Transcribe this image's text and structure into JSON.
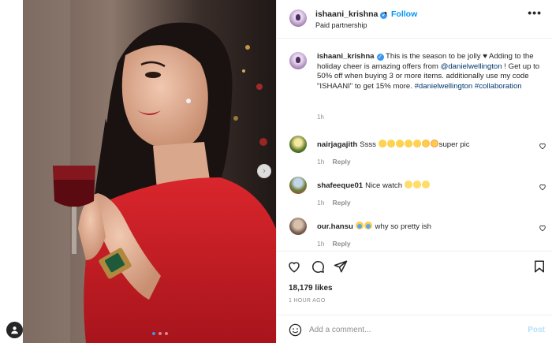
{
  "post": {
    "username": "ishaani_krishna",
    "separator": "•",
    "follow_label": "Follow",
    "subtitle": "Paid partnership",
    "more_label": "•••",
    "carousel_dots": 3,
    "active_dot": 0
  },
  "caption": {
    "username": "ishaani_krishna",
    "text_1": " This is the season to be jolly ",
    "heart": "♥",
    "text_2": " Adding to the holiday cheer is amazing offers from ",
    "mention": "@danielwellington",
    "text_3": " ! Get up to 50% off when buying 3 or more items. additionally use my code \"ISHAANI\" to get 15% more. ",
    "hashtag_1": "#danielwellington",
    "hashtag_2": "#collaboration",
    "time": "1h"
  },
  "comments": [
    {
      "username": "nairjagajith",
      "text_before": "Ssss ",
      "emojis": [
        "clap",
        "clap",
        "clap",
        "clap",
        "clap",
        "star",
        "heart"
      ],
      "text_after": "super pic",
      "time": "1h",
      "reply": "Reply"
    },
    {
      "username": "shafeeque01",
      "text_before": "Nice watch ",
      "emojis": [
        "smile",
        "smile",
        "smile"
      ],
      "text_after": "",
      "time": "1h",
      "reply": "Reply"
    },
    {
      "username": "our.hansu",
      "text_before": "",
      "emojis": [
        "cry",
        "cry"
      ],
      "text_after": " why so pretty ish",
      "time": "1h",
      "reply": "Reply"
    }
  ],
  "stats": {
    "likes": "18,179 likes",
    "posted": "1 HOUR AGO"
  },
  "composer": {
    "placeholder": "Add a comment...",
    "post_label": "Post"
  },
  "colors": {
    "accent": "#0095f6",
    "link": "#00376b",
    "muted": "#8e8e8e"
  }
}
